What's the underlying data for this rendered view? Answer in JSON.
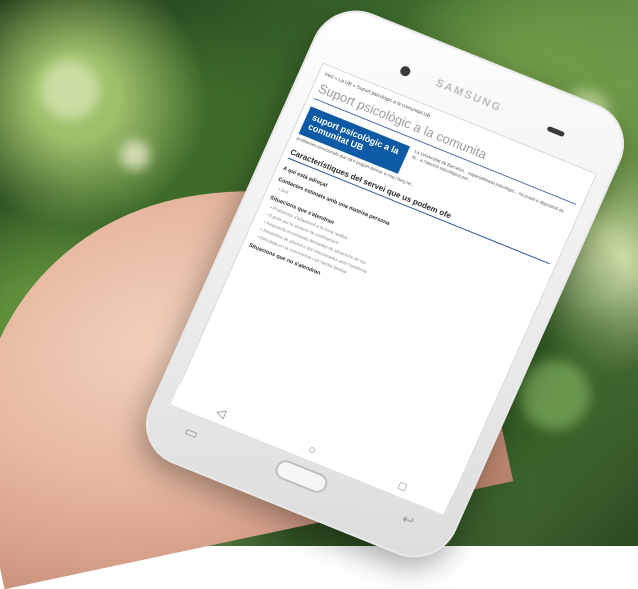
{
  "phone": {
    "brand": "SAMSUNG",
    "nav_back": "◁",
    "nav_home": "○",
    "nav_recent": "□"
  },
  "page": {
    "breadcrumb": "Inici » La UB » Suport psicològic a la comunitat UB",
    "title": "Suport psicològic a la comunita",
    "banner": "suport psicològic a la comunitat UB",
    "intro": "La Universitat de Barcelon... especialitzada psicològic... ha posat a disposició de la... a l'atenció psicològica per...",
    "intro_tail": "problemes emocionals que se'n puguin derivar a mig i llarg ter...",
    "section_title": "Característiques del servei que us podem ofe",
    "h_who": "A qui està adreçat",
    "h_contact": "Contactes estimats amb una mateixa persona",
    "contact_value": "Dos",
    "h_situations": "Situacions que s'atendran",
    "situations": [
      "Problemes d'adaptació a la nova realitat",
      "Estrès per la situació de confinament",
      "Reaccions emocionals derivades de situacions de risc",
      "Situacions de pèrdua o dol relacionades amb l'epidèmia",
      "Dificultats en la convivència i en l'àmbit familiar"
    ],
    "h_not_attended": "Situacions que no s'atendran"
  },
  "colors": {
    "banner_bg": "#0c5aa6",
    "rule": "#2d56a0"
  }
}
